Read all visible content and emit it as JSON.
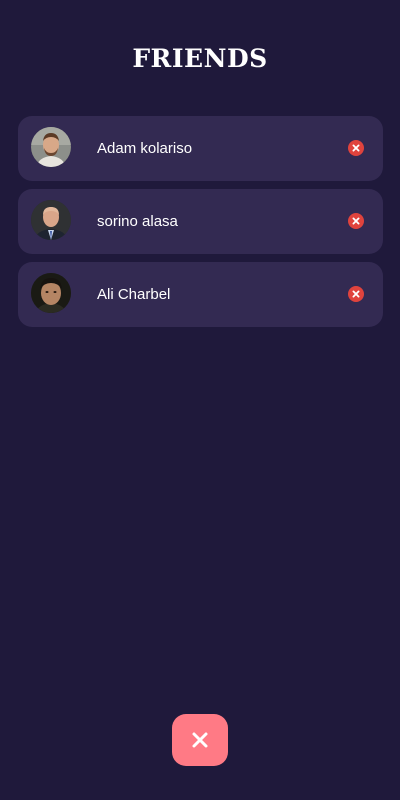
{
  "title": "FRIENDS",
  "friends": [
    {
      "name": "Adam kolariso"
    },
    {
      "name": "sorino alasa"
    },
    {
      "name": "Ali Charbel"
    }
  ],
  "icons": {
    "remove": "remove-icon",
    "close": "close-icon"
  },
  "colors": {
    "background": "#1f193b",
    "card": "#332a52",
    "remove": "#e0433d",
    "close_button": "#ff7a85"
  }
}
